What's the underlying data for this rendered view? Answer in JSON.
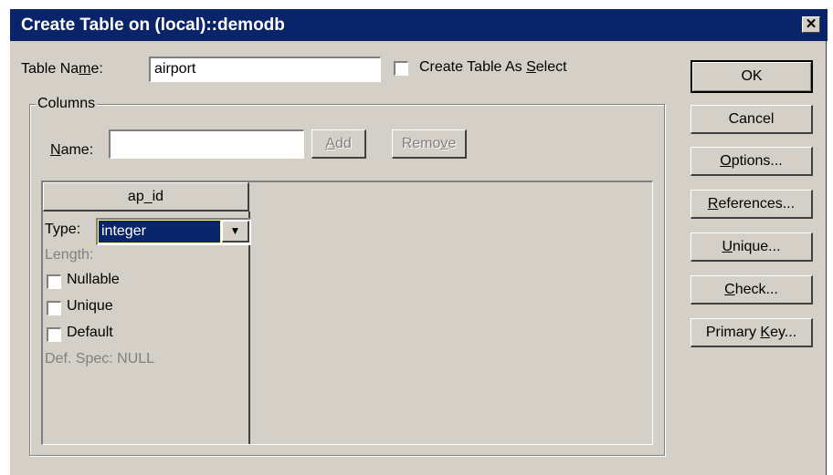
{
  "window": {
    "title": "Create Table on (local)::demodb",
    "close": "✕"
  },
  "table_name": {
    "label_pre": "Table Na",
    "label_ul": "m",
    "label_post": "e:",
    "value": "airport"
  },
  "create_as_select": {
    "label_pre": "Create Table As ",
    "label_ul": "S",
    "label_post": "elect",
    "checked": false
  },
  "columns_group": {
    "label": "Columns",
    "name_label_ul": "N",
    "name_label_post": "ame:",
    "name_value": "",
    "add": {
      "ul": "A",
      "post": "dd"
    },
    "remove": {
      "pre": "Remo",
      "ul": "v",
      "post": "e"
    }
  },
  "column": {
    "header": "ap_id",
    "type_label": "Type:",
    "type_value": "integer",
    "length_label": "Length:",
    "nullable": "Nullable",
    "unique": "Unique",
    "default": "Default",
    "def_spec": "Def. Spec: NULL"
  },
  "buttons": {
    "ok": "OK",
    "cancel": "Cancel",
    "options": {
      "ul": "O",
      "post": "ptions..."
    },
    "references": {
      "ul": "R",
      "post": "eferences..."
    },
    "unique": {
      "ul": "U",
      "post": "nique..."
    },
    "check": {
      "ul": "C",
      "post": "heck..."
    },
    "primary_key": {
      "pre": "Primary ",
      "ul": "K",
      "post": "ey..."
    }
  },
  "icons": {
    "dropdown": "triangle-down"
  },
  "colors": {
    "titlebar": "#0a246a",
    "face": "#d4d0c8",
    "selection": "#0a246a"
  }
}
